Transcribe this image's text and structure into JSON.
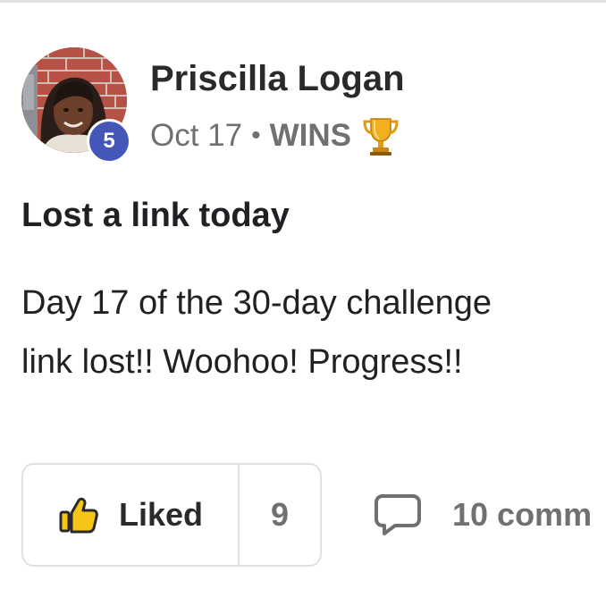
{
  "post": {
    "author": {
      "name": "Priscilla Logan",
      "level": "5",
      "avatar": "profile-photo"
    },
    "meta": {
      "date": "Oct 17",
      "separator": "•",
      "category": "WINS",
      "category_icon": "trophy-icon"
    },
    "title": "Lost a link today",
    "body_lines": [
      "Day 17 of the 30-day challenge",
      "link lost!! Woohoo! Progress!!"
    ],
    "actions": {
      "like_label": "Liked",
      "like_icon": "thumbs-up-icon",
      "like_count": "9",
      "comments_label": "10 comm",
      "comments_icon": "comment-bubble-icon"
    }
  },
  "colors": {
    "level_badge": "#4457b8",
    "like_icon": "#f5c518",
    "muted_text": "#707070",
    "border": "#e0e0e0"
  }
}
